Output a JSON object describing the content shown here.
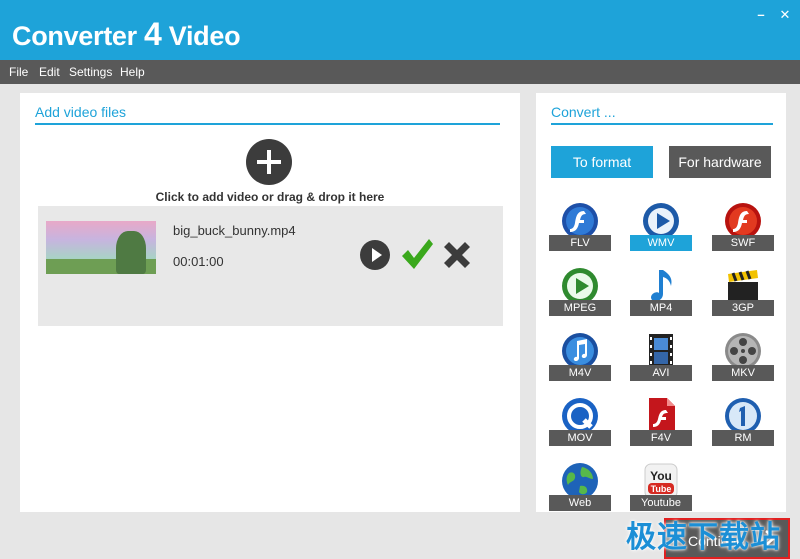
{
  "window": {
    "title_prefix": "Converter ",
    "title_number": "4",
    "title_suffix": " Video",
    "minimize_glyph": "–",
    "close_glyph": "✕"
  },
  "menu": {
    "items": [
      "File",
      "Edit",
      "Settings",
      "Help"
    ]
  },
  "add_panel": {
    "title": "Add video files",
    "hint": "Click to add video or drag & drop it here",
    "files": [
      {
        "name": "big_buck_bunny.mp4",
        "duration": "00:01:00"
      }
    ]
  },
  "convert_panel": {
    "title": "Convert ...",
    "tabs": [
      {
        "label": "To format",
        "selected": true
      },
      {
        "label": "For hardware",
        "selected": false
      }
    ],
    "formats": [
      {
        "label": "FLV",
        "icon": "flash-video-icon",
        "selected": false
      },
      {
        "label": "WMV",
        "icon": "windows-media-icon",
        "selected": true
      },
      {
        "label": "SWF",
        "icon": "flash-icon",
        "selected": false
      },
      {
        "label": "MPEG",
        "icon": "mpeg-player-icon",
        "selected": false
      },
      {
        "label": "MP4",
        "icon": "music-note-icon",
        "selected": false
      },
      {
        "label": "3GP",
        "icon": "clapperboard-icon",
        "selected": false
      },
      {
        "label": "M4V",
        "icon": "quicktime-note-icon",
        "selected": false
      },
      {
        "label": "AVI",
        "icon": "film-strip-icon",
        "selected": false
      },
      {
        "label": "MKV",
        "icon": "film-reel-icon",
        "selected": false
      },
      {
        "label": "MOV",
        "icon": "quicktime-icon",
        "selected": false
      },
      {
        "label": "F4V",
        "icon": "flash-document-icon",
        "selected": false
      },
      {
        "label": "RM",
        "icon": "realmedia-icon",
        "selected": false
      },
      {
        "label": "Web",
        "icon": "globe-icon",
        "selected": false
      },
      {
        "label": "Youtube",
        "icon": "youtube-icon",
        "selected": false
      }
    ]
  },
  "footer": {
    "continue_label": "Continue",
    "watermark": "极速下载站"
  },
  "colors": {
    "accent": "#1ea3d9",
    "dark": "#595959",
    "check": "#3aa81c"
  }
}
